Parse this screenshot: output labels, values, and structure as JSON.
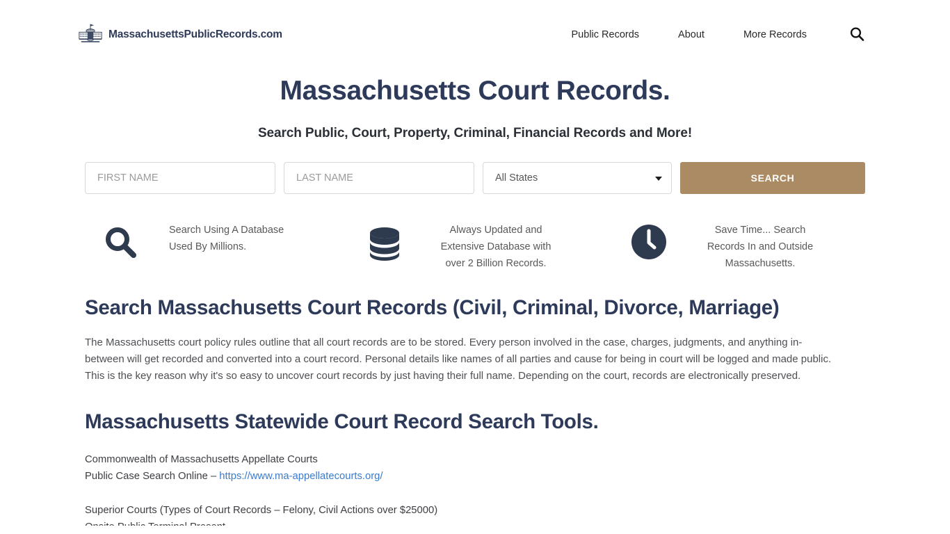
{
  "header": {
    "brand_name": "MassachusettsPublicRecords.com",
    "brand_icon": "capitol-building-icon",
    "nav": [
      {
        "label": "Public Records"
      },
      {
        "label": "About"
      },
      {
        "label": "More Records"
      }
    ],
    "search_icon": "search-icon"
  },
  "hero": {
    "title": "Massachusetts Court Records.",
    "subtitle": "Search Public, Court, Property, Criminal, Financial Records and More!"
  },
  "search_form": {
    "first_name_placeholder": "FIRST NAME",
    "first_name_value": "",
    "last_name_placeholder": "LAST NAME",
    "last_name_value": "",
    "state_selected": "All States",
    "state_options": [
      "All States"
    ],
    "submit_label": "SEARCH",
    "submit_color": "#ab8b63"
  },
  "features": [
    {
      "icon": "magnifier-icon",
      "text": "Search Using A Database Used By Millions."
    },
    {
      "icon": "database-icon",
      "text": "Always Updated and Extensive Database with over 2 Billion Records."
    },
    {
      "icon": "clock-icon",
      "text": "Save Time... Search Records In and Outside Massachusetts."
    }
  ],
  "article": {
    "heading_1": "Search Massachusetts Court Records (Civil, Criminal, Divorce, Marriage)",
    "paragraph_1": "The Massachusetts court policy rules outline that all court records are to be stored. Every person involved in the case, charges, judgments, and anything in-between will get recorded and converted into a court record. Personal details like names of all parties and cause for being in court will be logged and made public. This is the key reason why it's so easy to uncover court records by just having their full name. Depending on the court, records are electronically preserved.",
    "heading_2": "Massachusetts Statewide Court Record Search Tools.",
    "tools": [
      {
        "name": "Commonwealth of Massachusetts Appellate Courts",
        "line_prefix": "Public Case Search Online – ",
        "link": "https://www.ma-appellatecourts.org/"
      },
      {
        "name": "Superior Courts (Types of Court Records – Felony, Civil Actions over $25000)",
        "line_prefix": "Onsite Public Terminal Present.",
        "link": ""
      }
    ]
  },
  "colors": {
    "navy": "#2e3a59",
    "bronze": "#ab8b63",
    "link_blue": "#3a7bd0",
    "body_text": "#4d4f52"
  }
}
